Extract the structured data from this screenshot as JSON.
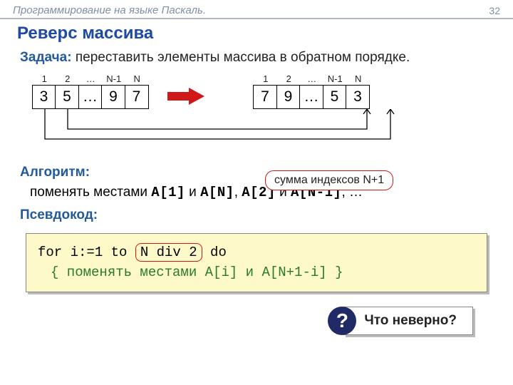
{
  "header": {
    "title": "Программирование на языке Паскаль.",
    "page": "32"
  },
  "title": "Реверс массива",
  "task": {
    "label": "Задача:",
    "text": " переставить элементы массива в обратном порядке."
  },
  "array_left": {
    "indices": [
      "1",
      "2",
      "…",
      "N-1",
      "N"
    ],
    "cells": [
      "3",
      "5",
      "…",
      "9",
      "7"
    ]
  },
  "array_right": {
    "indices": [
      "1",
      "2",
      "…",
      "N-1",
      "N"
    ],
    "cells": [
      "7",
      "9",
      "…",
      "5",
      "3"
    ]
  },
  "algo": {
    "label": "Алгоритм:",
    "line": "поменять местами ",
    "swap1a": "A[1]",
    "and": " и ",
    "swap1b": "A[N]",
    "sep": ", ",
    "swap2a": "A[2]",
    "swap2b": "A[N-1]",
    "tail": ", …"
  },
  "callout": "сумма индексов N+1",
  "pseudocode_label": "Псевдокод:",
  "code": {
    "line1_pre": "for i:=1 to ",
    "line1_box": "N div 2",
    "line1_post": " do",
    "line2": "{ поменять местами A[i] и A[N+1-i] }"
  },
  "question": {
    "mark": "?",
    "text": "Что неверно?"
  }
}
